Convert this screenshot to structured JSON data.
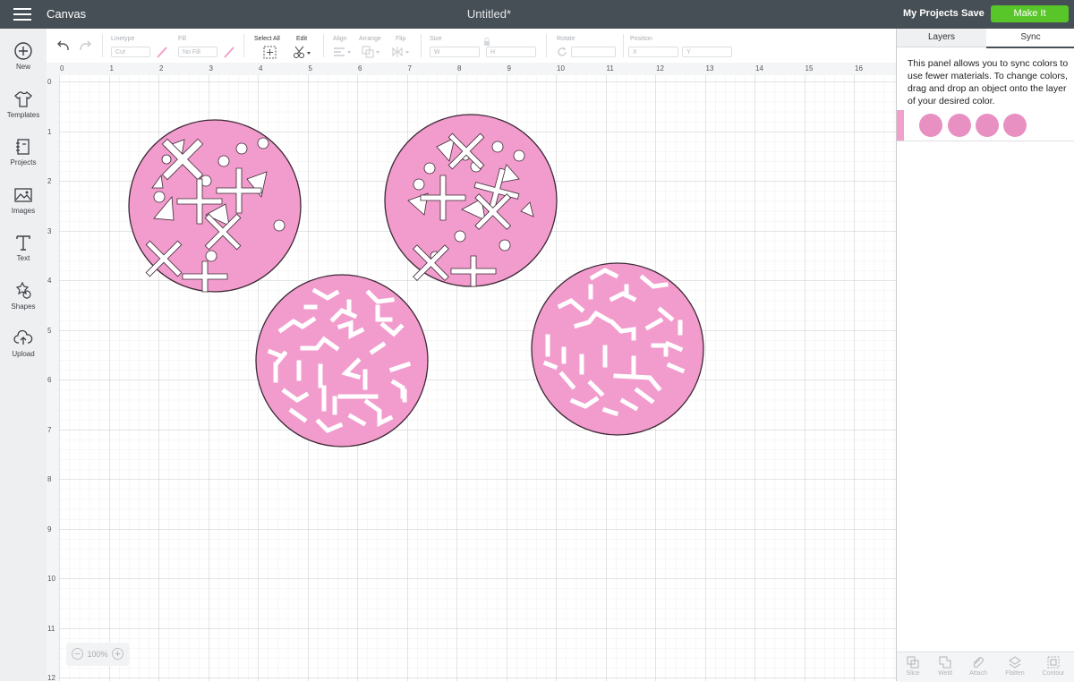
{
  "header": {
    "app_title": "Canvas",
    "doc_title": "Untitled*",
    "my_projects": "My Projects",
    "save": "Save",
    "make_it": "Make It"
  },
  "left_nav": [
    {
      "label": "New",
      "icon": "plus-circle-icon"
    },
    {
      "label": "Templates",
      "icon": "tshirt-icon"
    },
    {
      "label": "Projects",
      "icon": "notebook-icon"
    },
    {
      "label": "Images",
      "icon": "image-icon"
    },
    {
      "label": "Text",
      "icon": "text-t-icon"
    },
    {
      "label": "Shapes",
      "icon": "shapes-icon"
    },
    {
      "label": "Upload",
      "icon": "cloud-upload-icon"
    }
  ],
  "toolbar": {
    "linetype_label": "Linetype",
    "linetype_value": "Cut",
    "fill_label": "Fill",
    "fill_value": "No Fill",
    "select_all": "Select All",
    "edit": "Edit",
    "align": "Align",
    "arrange": "Arrange",
    "flip": "Flip",
    "size": "Size",
    "w": "W",
    "h": "H",
    "rotate": "Rotate",
    "position": "Position",
    "x": "X",
    "y": "Y"
  },
  "ruler": {
    "top": [
      "0",
      "1",
      "2",
      "3",
      "4",
      "5",
      "6",
      "7",
      "8",
      "9",
      "10",
      "11",
      "12",
      "13",
      "14",
      "15",
      "16"
    ],
    "left": [
      "0",
      "1",
      "2",
      "3",
      "4",
      "5",
      "6",
      "7",
      "8",
      "9",
      "10",
      "11",
      "12"
    ]
  },
  "zoom": {
    "value": "100%",
    "minus": "−",
    "plus": "+"
  },
  "right_panel": {
    "tabs": [
      "Layers",
      "Sync"
    ],
    "active_tab": "Sync",
    "sync_text": "This panel allows you to sync colors to use fewer materials. To change colors, drag and drop an object onto the layer of your desired color.",
    "swatch_color": "#e990c2",
    "swatch_count": 4,
    "bottom_actions": [
      "Slice",
      "Weld",
      "Attach",
      "Flatten",
      "Contour"
    ]
  },
  "colors": {
    "topbar": "#474f56",
    "make_it": "#58c629",
    "circle_fill": "#f29bcd",
    "circle_stroke": "#3d2a35"
  }
}
